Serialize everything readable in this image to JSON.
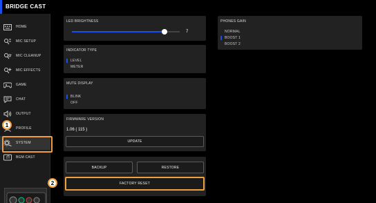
{
  "app": {
    "title": "BRIDGE CAST"
  },
  "sidebar": {
    "items": [
      {
        "label": "HOME",
        "icon": "keyboard-icon"
      },
      {
        "label": "MIC SETUP",
        "icon": "mic-setup-icon"
      },
      {
        "label": "MIC CLEANUP",
        "icon": "mic-cleanup-icon"
      },
      {
        "label": "MIC EFFECTS",
        "icon": "mic-effects-icon"
      },
      {
        "label": "GAME",
        "icon": "gamepad-icon"
      },
      {
        "label": "CHAT",
        "icon": "chat-icon"
      },
      {
        "label": "OUTPUT",
        "icon": "speaker-icon"
      },
      {
        "label": "PROFILE",
        "icon": "profile-icon"
      },
      {
        "label": "SYSTEM",
        "icon": "gear-icon"
      },
      {
        "label": "BGM CAST",
        "icon": "bgm-icon"
      }
    ]
  },
  "callouts": {
    "one": "1",
    "two": "2"
  },
  "led": {
    "title": "LED BRIGHTNESS",
    "value": "7",
    "level": 0.86
  },
  "indicator": {
    "title": "INDICATOR TYPE",
    "options": [
      "LEVEL",
      "METER"
    ],
    "selected": 0
  },
  "mute": {
    "title": "MUTE DISPLAY",
    "options": [
      "BLINK",
      "OFF"
    ],
    "selected": 0
  },
  "firmware": {
    "title": "FIRMWARE VERSION",
    "version": "1.06 ( 115 )",
    "update_label": "UPDATE"
  },
  "backup": {
    "backup_label": "BACKUP",
    "restore_label": "RESTORE",
    "reset_label": "FACTORY RESET"
  },
  "phones": {
    "title": "PHONES GAIN",
    "options": [
      "NORMAL",
      "BOOST 1",
      "BOOST 2"
    ],
    "selected": 1
  },
  "colors": {
    "accent": "#1a4ff0",
    "highlight": "#f0a03c"
  }
}
